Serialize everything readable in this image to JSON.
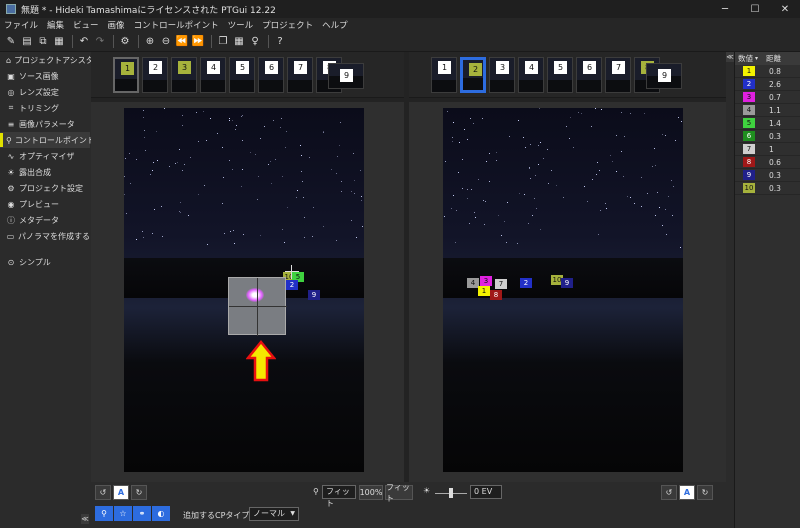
{
  "window": {
    "title": "無題 * - Hideki Tamashimaにライセンスされた PTGui 12.22",
    "minimize": "─",
    "maximize": "☐",
    "close": "✕"
  },
  "menu": [
    "ファイル",
    "編集",
    "ビュー",
    "画像",
    "コントロールポイント",
    "ツール",
    "プロジェクト",
    "ヘルプ"
  ],
  "toolbar_icons": [
    "new-icon",
    "open-icon",
    "copy-icon",
    "save-icon",
    "undo-icon",
    "redo-icon",
    "settings-icon",
    "zoom-in-icon",
    "zoom-out-icon",
    "prev-icon",
    "next-icon",
    "layout-icon",
    "grid-icon",
    "hint-icon",
    "help-icon"
  ],
  "sidebar": {
    "items": [
      {
        "label": "プロジェクトアシスタント",
        "icon": "home-icon",
        "glyph": "⌂"
      },
      {
        "label": "ソース画像",
        "icon": "images-icon",
        "glyph": "▣"
      },
      {
        "label": "レンズ設定",
        "icon": "lens-icon",
        "glyph": "◎"
      },
      {
        "label": "トリミング",
        "icon": "crop-icon",
        "glyph": "⌗"
      },
      {
        "label": "画像パラメータ",
        "icon": "sliders-icon",
        "glyph": "≡"
      },
      {
        "label": "コントロールポイント",
        "icon": "pin-icon",
        "glyph": "⚲"
      },
      {
        "label": "オプティマイザ",
        "icon": "optimizer-icon",
        "glyph": "∿"
      },
      {
        "label": "露出合成",
        "icon": "exposure-icon",
        "glyph": "☀"
      },
      {
        "label": "プロジェクト設定",
        "icon": "gear-icon",
        "glyph": "⚙"
      },
      {
        "label": "プレビュー",
        "icon": "eye-icon",
        "glyph": "◉"
      },
      {
        "label": "メタデータ",
        "icon": "info-icon",
        "glyph": "ⓘ"
      },
      {
        "label": "パノラマを作成する",
        "icon": "panorama-icon",
        "glyph": "▭"
      }
    ],
    "simple": {
      "label": "シンプル",
      "icon": "chevron-up-icon",
      "glyph": "⊙"
    }
  },
  "left_strip": [
    "1",
    "2",
    "3",
    "4",
    "5",
    "6",
    "7",
    "8",
    "9"
  ],
  "right_strip": [
    "1",
    "2",
    "3",
    "4",
    "5",
    "6",
    "7",
    "8",
    "9"
  ],
  "left_cps": [
    {
      "n": "10",
      "c": "#a6b23c"
    },
    {
      "n": "5",
      "c": "#3fd23f"
    },
    {
      "n": "2",
      "c": "#2230c8"
    },
    {
      "n": "9",
      "c": "#20208a"
    }
  ],
  "right_cps": [
    {
      "n": "4",
      "c": "#9a9a9a"
    },
    {
      "n": "3",
      "c": "#e020e0"
    },
    {
      "n": "1",
      "c": "#f2f200"
    },
    {
      "n": "7",
      "c": "#cfcfcf"
    },
    {
      "n": "8",
      "c": "#a01818"
    },
    {
      "n": "2",
      "c": "#2230c8"
    },
    {
      "n": "10",
      "c": "#a6b23c"
    },
    {
      "n": "9",
      "c": "#20208a"
    }
  ],
  "cp_table": {
    "col_num": "数値",
    "col_dist": "距離",
    "rows": [
      {
        "n": "1",
        "d": "0.8",
        "c": "#f2f200"
      },
      {
        "n": "2",
        "d": "2.6",
        "c": "#2230c8"
      },
      {
        "n": "3",
        "d": "0.7",
        "c": "#e020e0"
      },
      {
        "n": "4",
        "d": "1.1",
        "c": "#9a9a9a"
      },
      {
        "n": "5",
        "d": "1.4",
        "c": "#3fd23f"
      },
      {
        "n": "6",
        "d": "0.3",
        "c": "#1f8f1f"
      },
      {
        "n": "7",
        "d": "1",
        "c": "#cfcfcf"
      },
      {
        "n": "8",
        "d": "0.6",
        "c": "#a01818"
      },
      {
        "n": "9",
        "d": "0.3",
        "c": "#20208a"
      },
      {
        "n": "10",
        "d": "0.3",
        "c": "#a6b23c"
      }
    ]
  },
  "bottom": {
    "auto": "A",
    "fit1": "フィット",
    "zoom": "100%",
    "fit2": "フィット",
    "ev": "0 EV",
    "cp_type_label": "追加するCPタイプ：",
    "cp_type_value": "ノーマル"
  },
  "collapse": "≪"
}
